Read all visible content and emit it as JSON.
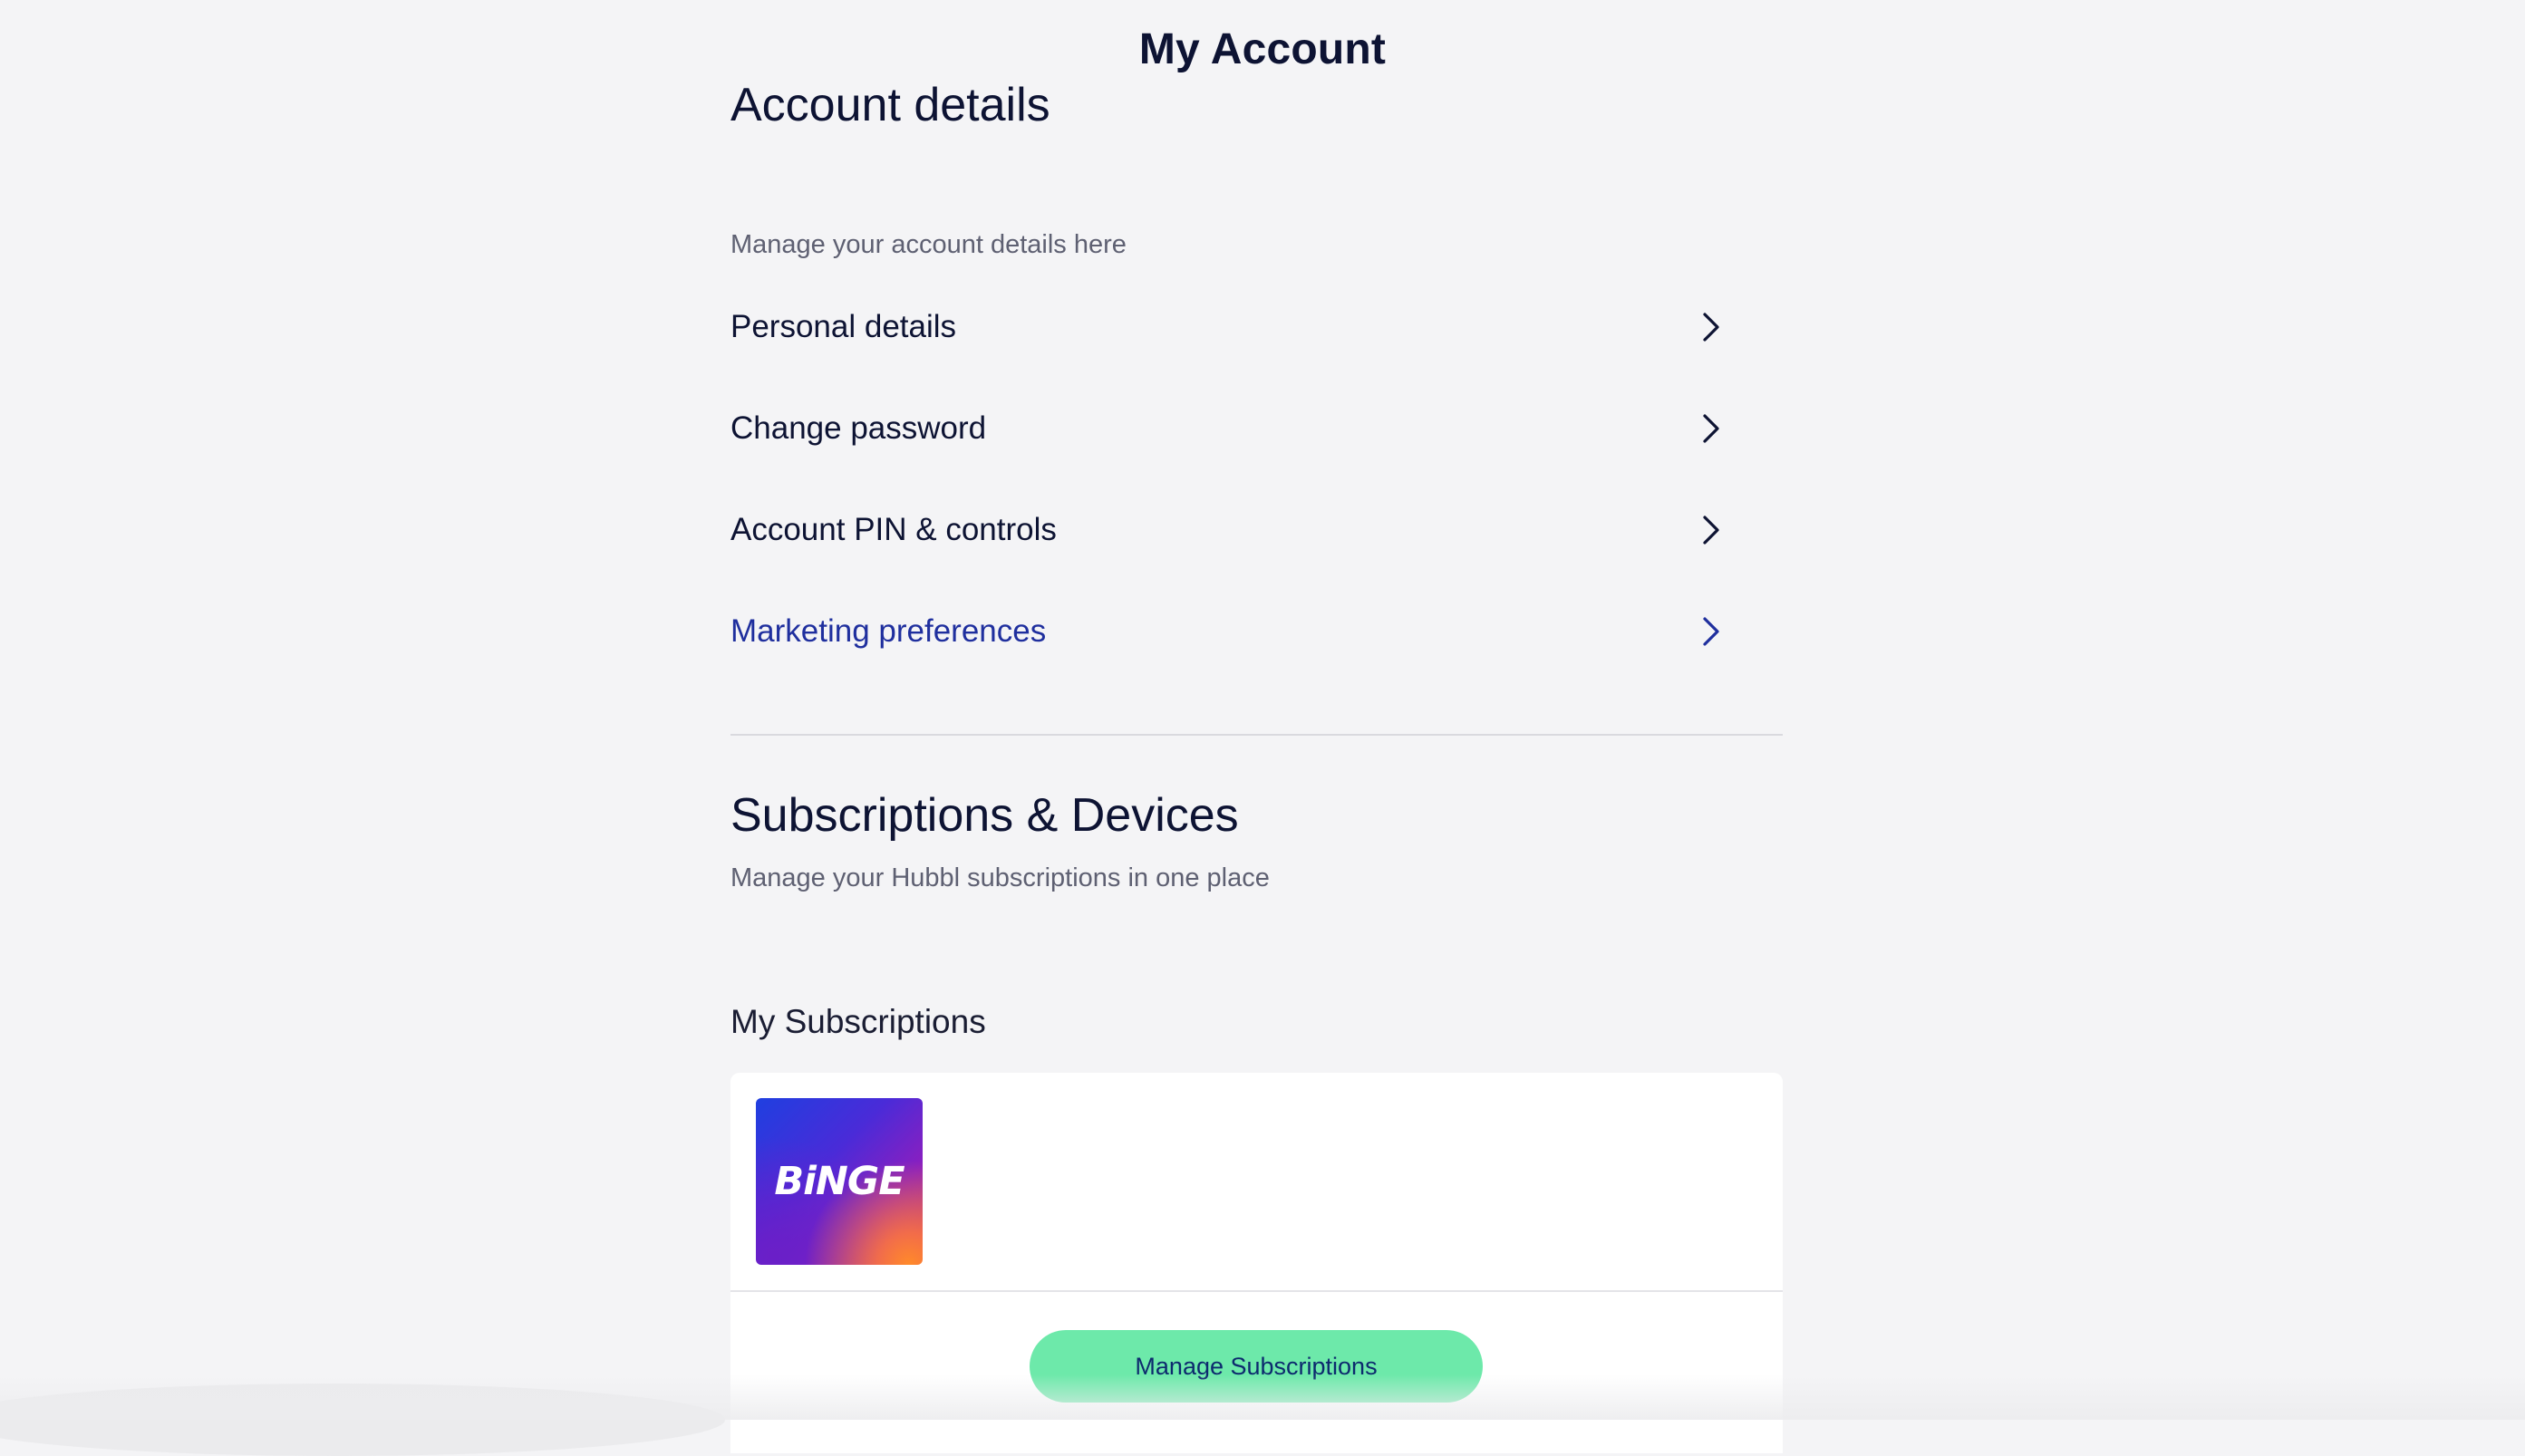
{
  "page": {
    "title": "My Account"
  },
  "account_details": {
    "heading": "Account details",
    "subtitle": "Manage your account details here",
    "items": [
      {
        "label": "Personal details"
      },
      {
        "label": "Change password"
      },
      {
        "label": "Account PIN & controls"
      },
      {
        "label": "Marketing preferences"
      }
    ]
  },
  "subscriptions_devices": {
    "heading": "Subscriptions & Devices",
    "subtitle": "Manage your Hubbl subscriptions in one place",
    "my_subscriptions_label": "My Subscriptions",
    "subscriptions": [
      {
        "logo_text": "BiNGE",
        "icon": "binge-logo"
      }
    ],
    "manage_button_label": "Manage Subscriptions"
  },
  "colors": {
    "background": "#f4f4f6",
    "text_primary": "#0d1333",
    "link": "#1f2f9e",
    "button_bg": "#6de9aa"
  }
}
